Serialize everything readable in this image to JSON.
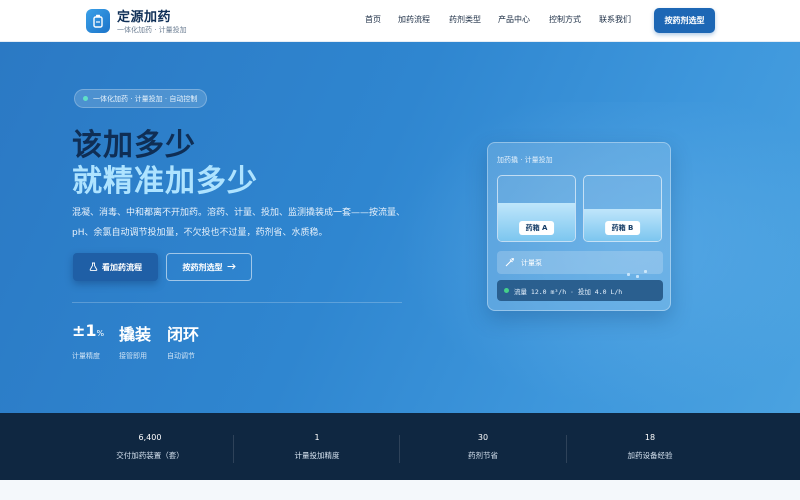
{
  "brand": {
    "title": "定源加药",
    "subtitle": "一体化加药 · 计量投加",
    "logo_icon": "doser-icon"
  },
  "nav": {
    "items": [
      "首页",
      "加药流程",
      "药剂类型",
      "产品中心",
      "控制方式",
      "联系我们"
    ],
    "cta": "按药剂选型"
  },
  "hero": {
    "pill": "一体化加药 · 计量投加 · 自动控制",
    "headline_1": "该加多少",
    "headline_2": "就精准加多少",
    "description": "混凝、消毒、中和都离不开加药。溶药、计量、投加、监测撬装成一套——按流量、pH、余氯自动调节投加量，不欠投也不过量，药剂省、水质稳。",
    "primary_button": "看加药流程",
    "secondary_button": "按药剂选型",
    "stats": [
      {
        "value": "±1",
        "unit": "%",
        "label": "计量精度"
      },
      {
        "value": "撬装",
        "unit": "",
        "label": "接管即用"
      },
      {
        "value": "闭环",
        "unit": "",
        "label": "自动调节"
      }
    ]
  },
  "panel": {
    "header": "加药撬 · 计量投加",
    "tanks": [
      {
        "label": "药箱 A",
        "level": 0.58
      },
      {
        "label": "药箱 B",
        "level": 0.5
      }
    ],
    "pump_label": "计量泵",
    "readout": "流量 12.0 m³/h · 投加 4.0 L/h"
  },
  "stats_bar": [
    {
      "value": "6,400",
      "label": "交付加药装置（套）"
    },
    {
      "value": "1",
      "label": "计量投加精度"
    },
    {
      "value": "30",
      "label": "药剂节省"
    },
    {
      "value": "18",
      "label": "加药设备经验"
    }
  ],
  "colors": {
    "accent": "#1d67b5",
    "hero_bg": "#2f86d0",
    "dark_bar": "#0f2741",
    "highlight": "#aee3ff"
  }
}
